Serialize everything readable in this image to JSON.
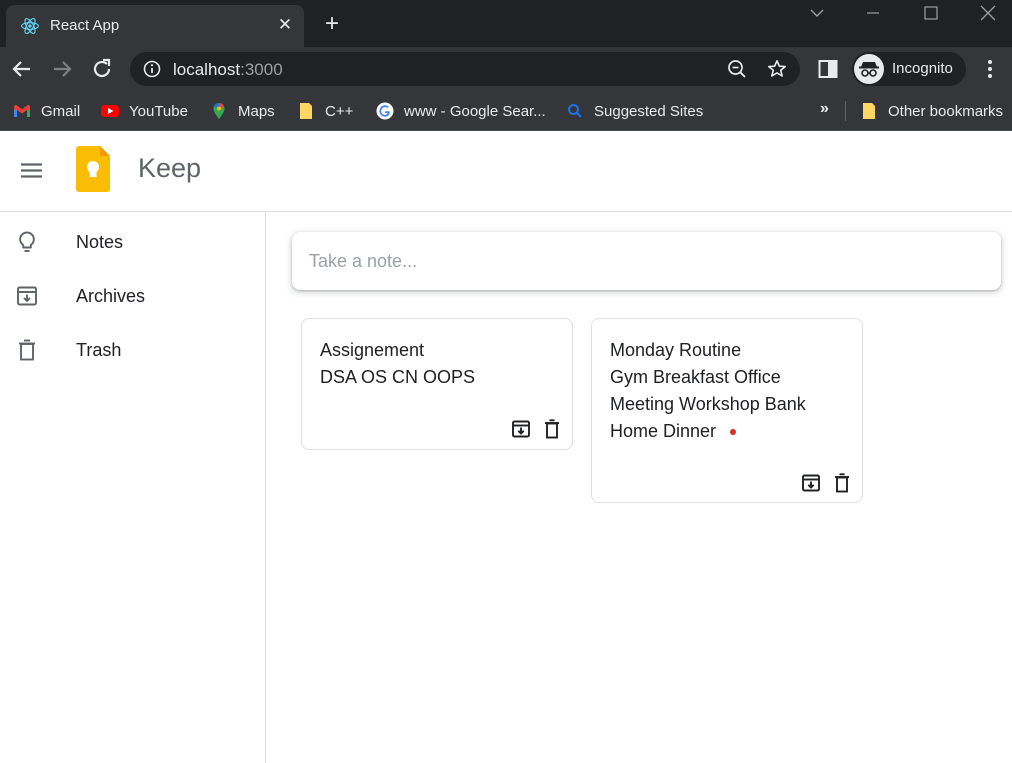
{
  "browser": {
    "tab_title": "React App",
    "url_host": "localhost",
    "url_port": ":3000",
    "profile_label": "Incognito",
    "bookmarks": [
      {
        "label": "Gmail",
        "icon": "gmail-icon"
      },
      {
        "label": "YouTube",
        "icon": "youtube-icon"
      },
      {
        "label": "Maps",
        "icon": "maps-icon"
      },
      {
        "label": "C++",
        "icon": "folder-icon"
      },
      {
        "label": "www - Google Sear...",
        "icon": "google-icon"
      },
      {
        "label": "Suggested Sites",
        "icon": "search-icon"
      }
    ],
    "other_bookmarks": "Other bookmarks",
    "overflow_glyph": "»"
  },
  "app": {
    "title": "Keep",
    "sidebar": {
      "items": [
        {
          "label": "Notes",
          "icon": "lightbulb-icon"
        },
        {
          "label": "Archives",
          "icon": "archive-icon"
        },
        {
          "label": "Trash",
          "icon": "trash-icon"
        }
      ]
    },
    "take_note_placeholder": "Take a note...",
    "notes": [
      {
        "lines": [
          "Assignement",
          "DSA OS CN OOPS"
        ]
      },
      {
        "lines": [
          "Monday Routine",
          "Gym Breakfast Office",
          "Meeting Workshop Bank",
          "Home Dinner"
        ]
      }
    ]
  },
  "colors": {
    "chrome_dark": "#202124",
    "chrome_toolbar": "#35363a",
    "keep_yellow": "#fbbc04",
    "text": "#202124",
    "muted": "#5f6368",
    "cursor_dot": "#d93025"
  }
}
